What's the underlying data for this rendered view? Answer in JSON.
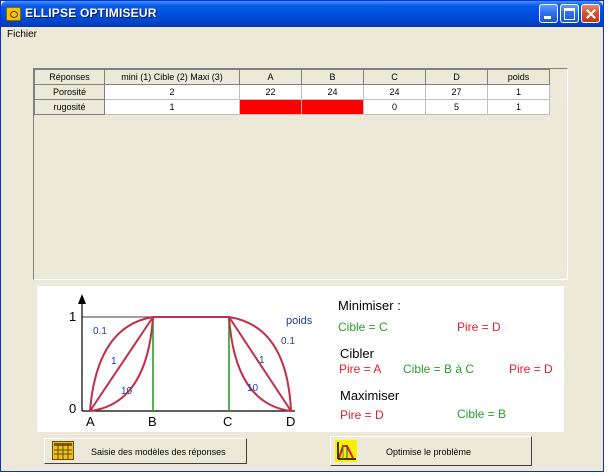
{
  "window": {
    "title": "ELLIPSE OPTIMISEUR"
  },
  "menu": {
    "fichier": "Fichier"
  },
  "grid": {
    "headers": [
      "Réponses",
      "mini (1) Cible (2) Maxi (3)",
      "A",
      "B",
      "C",
      "D",
      "poids"
    ],
    "rows": [
      {
        "name": "Porosité",
        "mode": "2",
        "A": "22",
        "B": "24",
        "C": "24",
        "D": "27",
        "poids": "1"
      },
      {
        "name": "rugosité",
        "mode": "1",
        "A": "",
        "B": "",
        "C": "0",
        "D": "5",
        "poids": "1"
      }
    ]
  },
  "diagram": {
    "y_top": "1",
    "y_zero": "0",
    "x_labels": [
      "A",
      "B",
      "C",
      "D"
    ],
    "weight_label": "poids",
    "curve_labels_left": [
      "0.1",
      "1",
      "10"
    ],
    "curve_labels_right": [
      "0.1",
      "1",
      "10"
    ],
    "minimiser": {
      "title": "Minimiser :",
      "cible": "Cible = C",
      "pire": "Pire = D"
    },
    "cibler": {
      "title": "Cibler",
      "pire_a": "Pire = A",
      "cible": "Cible = B à C",
      "pire_d": "Pire = D"
    },
    "maximiser": {
      "title": "Maximiser",
      "pire": "Pire = D",
      "cible": "Cible = B"
    },
    "colors": {
      "curve": "#c0304a",
      "green": "#2aa02a",
      "red": "#e8202a",
      "blue": "#2040a0"
    }
  },
  "buttons": {
    "saisie": "Saisie des modèles des réponses",
    "optimise": "Optimise le problème"
  },
  "icons": {
    "title": "ellipse-app-icon",
    "saisie": "grid-table-icon",
    "optimise": "chart-optimise-icon"
  }
}
